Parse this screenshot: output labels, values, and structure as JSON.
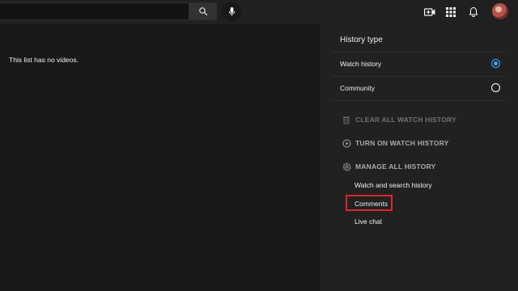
{
  "search": {
    "placeholder": ""
  },
  "icons": {
    "search": "search-icon",
    "mic": "mic-icon",
    "create": "create-video-icon",
    "apps": "apps-grid-icon",
    "notifications": "bell-icon",
    "avatar": "avatar"
  },
  "main": {
    "empty_message": "This list has no videos."
  },
  "sidebar": {
    "title": "History type",
    "options": [
      {
        "label": "Watch history",
        "selected": true
      },
      {
        "label": "Community",
        "selected": false
      }
    ],
    "actions": [
      {
        "label": "CLEAR ALL WATCH HISTORY",
        "icon": "trash-icon",
        "enabled": false
      },
      {
        "label": "TURN ON WATCH HISTORY",
        "icon": "play-circle-icon",
        "enabled": true
      },
      {
        "label": "MANAGE ALL HISTORY",
        "icon": "gear-icon",
        "enabled": true
      }
    ],
    "manage_links": [
      "Watch and search history",
      "Comments",
      "Live chat"
    ]
  },
  "colors": {
    "accent": "#3ea6ff",
    "highlight": "#e3242b",
    "background": "#181818",
    "sidebar": "#212121"
  }
}
